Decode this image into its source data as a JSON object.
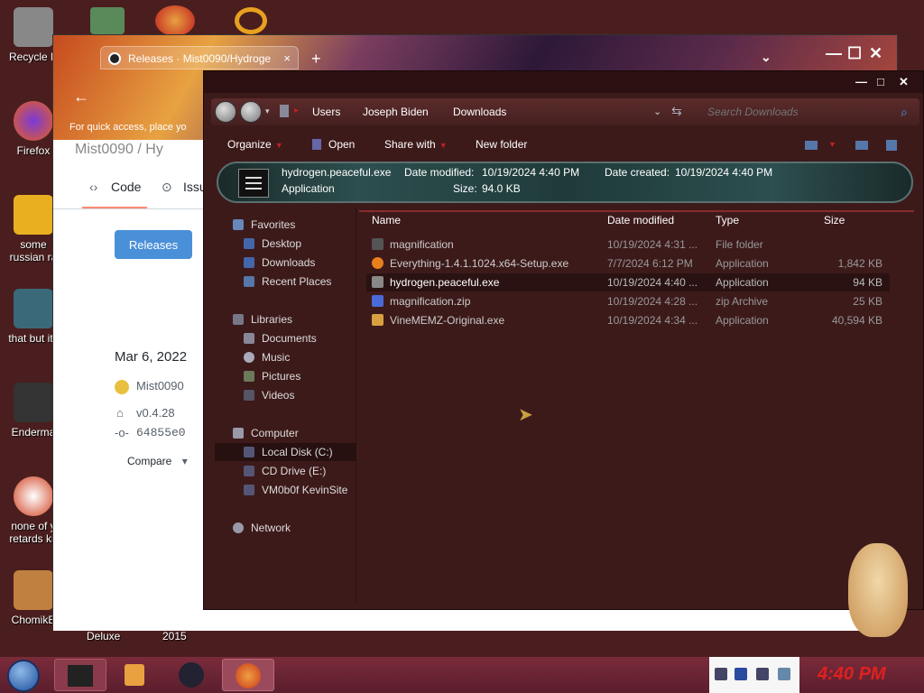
{
  "desktop": {
    "icons": [
      {
        "label": "Recycle B",
        "color": "#888888"
      },
      {
        "label": "Firefox",
        "color": "#e8601c"
      },
      {
        "label": "some",
        "label2": "russian ra",
        "color": "#e8b020"
      },
      {
        "label": "that but its",
        "color": "#3a6a7a"
      },
      {
        "label": "Enderma",
        "color": "#333333"
      },
      {
        "label": "none of y",
        "label2": "retards kn",
        "color": "#d04020"
      },
      {
        "label": "ChomikB",
        "color": "#c08040"
      }
    ],
    "strip_labels": [
      "Deluxe",
      "2015"
    ]
  },
  "browser": {
    "tab_title": "Releases · Mist0090/Hydroge",
    "tab_close": "×",
    "new_tab": "+",
    "quick_access": "For quick access, place yo",
    "repo_title": "Mist0090 / Hy",
    "nav_code": "Code",
    "nav_issues": "Issu",
    "releases_button": "Releases",
    "date": "Mar 6, 2022",
    "author": "Mist0090",
    "tag": "v0.4.28",
    "commit": "64855e0",
    "compare": "Compare"
  },
  "explorer": {
    "breadcrumb": [
      "Users",
      "Joseph Biden",
      "Downloads"
    ],
    "search_placeholder": "Search Downloads",
    "toolbar": {
      "organize": "Organize",
      "open": "Open",
      "share": "Share with",
      "new_folder": "New folder"
    },
    "details": {
      "name": "hydrogen.peaceful.exe",
      "type": "Application",
      "modified_label": "Date modified:",
      "modified": "10/19/2024 4:40 PM",
      "created_label": "Date created:",
      "created": "10/19/2024 4:40 PM",
      "size_label": "Size:",
      "size": "94.0 KB"
    },
    "nav": {
      "favorites": "Favorites",
      "desktop": "Desktop",
      "downloads": "Downloads",
      "recent": "Recent Places",
      "libraries": "Libraries",
      "documents": "Documents",
      "music": "Music",
      "pictures": "Pictures",
      "videos": "Videos",
      "computer": "Computer",
      "local_disk": "Local Disk (C:)",
      "cd_drive": "CD Drive (E:)",
      "vm": "VM0b0f KevinSite",
      "network": "Network"
    },
    "columns": {
      "name": "Name",
      "modified": "Date modified",
      "type": "Type",
      "size": "Size"
    },
    "files": [
      {
        "name": "magnification",
        "modified": "10/19/2024 4:31 ...",
        "type": "File folder",
        "size": "",
        "icon_color": "#555555"
      },
      {
        "name": "Everything-1.4.1.1024.x64-Setup.exe",
        "modified": "7/7/2024 6:12 PM",
        "type": "Application",
        "size": "1,842 KB",
        "icon_color": "#e8801c"
      },
      {
        "name": "hydrogen.peaceful.exe",
        "modified": "10/19/2024 4:40 ...",
        "type": "Application",
        "size": "94 KB",
        "icon_color": "#888888"
      },
      {
        "name": "magnification.zip",
        "modified": "10/19/2024 4:28 ...",
        "type": "zip Archive",
        "size": "25 KB",
        "icon_color": "#4a6ad8"
      },
      {
        "name": "VineMEMZ-Original.exe",
        "modified": "10/19/2024 4:34 ...",
        "type": "Application",
        "size": "40,594 KB",
        "icon_color": "#d8a040"
      }
    ]
  },
  "taskbar": {
    "clock": "4:40 PM"
  },
  "colors": {
    "desktop_bg": "#4a1e1e",
    "explorer_bg": "#3d1a1a",
    "clock": "#e02020",
    "taskbar": "#7a2b3b"
  }
}
